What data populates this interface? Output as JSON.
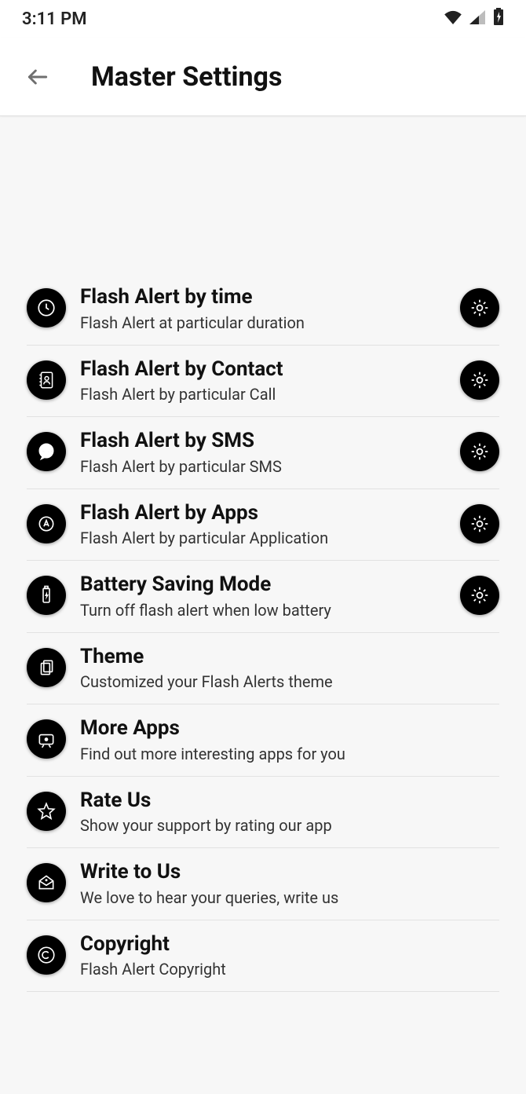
{
  "status": {
    "time": "3:11 PM"
  },
  "header": {
    "title": "Master Settings"
  },
  "items": [
    {
      "title": "Flash Alert by time",
      "sub": "Flash Alert at particular duration",
      "gear": true
    },
    {
      "title": "Flash Alert by Contact",
      "sub": "Flash Alert by particular Call",
      "gear": true
    },
    {
      "title": "Flash Alert by SMS",
      "sub": "Flash Alert by particular SMS",
      "gear": true
    },
    {
      "title": "Flash Alert by Apps",
      "sub": "Flash Alert by particular Application",
      "gear": true
    },
    {
      "title": "Battery Saving Mode",
      "sub": "Turn off flash alert when low battery",
      "gear": true
    },
    {
      "title": "Theme",
      "sub": "Customized your Flash Alerts theme",
      "gear": false
    },
    {
      "title": "More Apps",
      "sub": "Find out more interesting apps for you",
      "gear": false
    },
    {
      "title": "Rate Us",
      "sub": "Show your support by rating our app",
      "gear": false
    },
    {
      "title": "Write to Us",
      "sub": "We love to hear your queries, write us",
      "gear": false
    },
    {
      "title": "Copyright",
      "sub": "Flash Alert Copyright",
      "gear": false
    }
  ]
}
